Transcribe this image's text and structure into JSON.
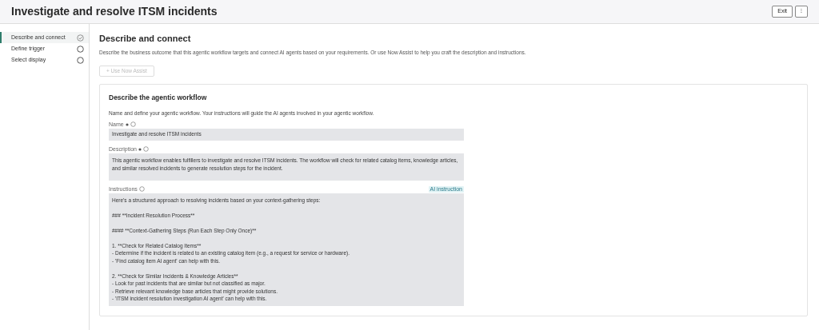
{
  "header": {
    "title": "Investigate and resolve ITSM incidents",
    "buttons": [
      "Exit",
      "⁝"
    ]
  },
  "steps": [
    {
      "label": "Describe and connect",
      "selected": true,
      "completed": true
    },
    {
      "label": "Define trigger",
      "selected": false,
      "completed": false
    },
    {
      "label": "Select display",
      "selected": false,
      "completed": false
    }
  ],
  "main": {
    "title": "Describe and connect",
    "subtitle": "Describe the business outcome that this agentic workflow targets and connect AI agents based on your requirements. Or use Now Assist to help you craft the description and instructions.",
    "assist_button": {
      "label": "+ Use Now Assist",
      "disabled": true
    }
  },
  "card": {
    "title": "Describe the agentic workflow",
    "intro": "Name and define your agentic workflow. Your instructions will guide the AI agents involved in your agentic workflow.",
    "fields": [
      {
        "label": "Name",
        "required": true,
        "value": "Investigate and resolve ITSM incidents",
        "kind": "input"
      },
      {
        "label": "Description",
        "required": true,
        "value": "This agentic workflow enables fulfillers to investigate and resolve ITSM incidents. The workflow will check for related catalog items, knowledge articles, and similar resolved incidents to generate resolution steps for the incident.",
        "kind": "textarea"
      },
      {
        "label": "Instructions",
        "required": false,
        "badge": "AI instruction",
        "value": "Here's a structured approach to resolving incidents based on your context-gathering steps:\n\n### **Incident Resolution Process**\n\n#### **Context-Gathering Steps (Run Each Step Only Once)**\n\n1. **Check for Related Catalog Items**\n- Determine if the incident is related to an existing catalog item (e.g., a request for service or hardware).\n- 'Find catalog item AI agent' can help with this.\n\n2. **Check for Similar Incidents & Knowledge Articles**\n- Look for past incidents that are similar but not classified as major.\n- Retrieve relevant knowledge base articles that might provide solutions.\n- 'ITSM incident resolution investigation AI agent' can help with this.",
        "kind": "textarea"
      }
    ]
  }
}
